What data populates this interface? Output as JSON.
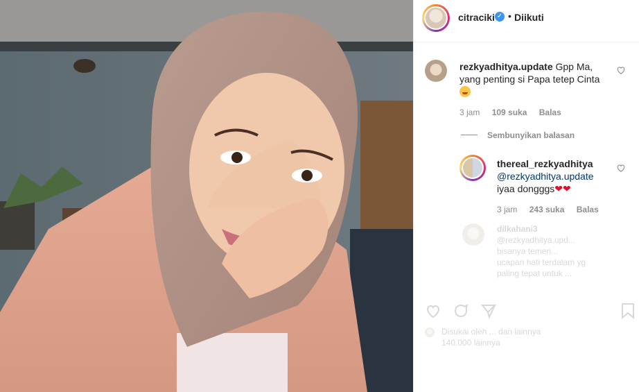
{
  "photo": {
    "alt_subject": "portrait-photo"
  },
  "header": {
    "username": "citraciki",
    "separator": "•",
    "follow_status": "Diikuti"
  },
  "comments": [
    {
      "username": "rezkyadhitya.update",
      "text": "Gpp Ma, yang penting si Papa tetep Cinta",
      "time": "3 jam",
      "likes": "109 suka",
      "reply_label": "Balas"
    }
  ],
  "hide_replies_label": "Sembunyikan balasan",
  "replies": [
    {
      "username": "thereal_rezkyadhitya",
      "mention": "@rezkyadhitya.update",
      "text": "iyaa dongggs",
      "time": "3 jam",
      "likes": "243 suka",
      "reply_label": "Balas"
    }
  ],
  "faded_comment": {
    "username": "dilkahani3",
    "lines": [
      "@rezkyadhitya.upd...",
      "bisanya temen...",
      "ucapan hati terdalam yg",
      "paling tepat untuk ..."
    ]
  },
  "faded_footer": {
    "liked_by": "Disukai oleh ... dan lainnya",
    "count": "140.000 lainnya"
  },
  "colors": {
    "accent": "#3897f0",
    "heart": "#e0102a",
    "muted": "#8e8e8e"
  }
}
